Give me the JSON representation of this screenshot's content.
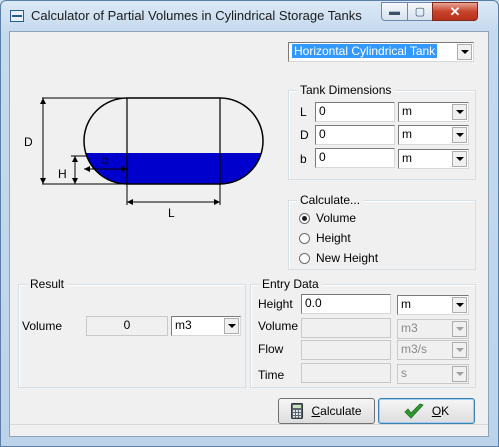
{
  "window": {
    "title": "Calculator of Partial Volumes in Cylindrical Storage Tanks",
    "min_glyph": "▬",
    "max_glyph": "▢",
    "close_glyph": "✕"
  },
  "tank_type": {
    "selected": "Horizontal Cylindrical Tank"
  },
  "diagram": {
    "label_D": "D",
    "label_H": "H",
    "label_b": "b",
    "label_L": "L",
    "liquid_color": "#0000cc"
  },
  "dimensions": {
    "title": "Tank Dimensions",
    "rows": [
      {
        "label": "L",
        "value": "0",
        "unit": "m"
      },
      {
        "label": "D",
        "value": "0",
        "unit": "m"
      },
      {
        "label": "b",
        "value": "0",
        "unit": "m"
      }
    ]
  },
  "calculate": {
    "title": "Calculate...",
    "options": [
      {
        "label": "Volume",
        "selected": true
      },
      {
        "label": "Height",
        "selected": false
      },
      {
        "label": "New Height",
        "selected": false
      }
    ]
  },
  "result": {
    "title": "Result",
    "label": "Volume",
    "value": "0",
    "unit": "m3"
  },
  "entry": {
    "title": "Entry Data",
    "rows": [
      {
        "label": "Height",
        "value": "0.0",
        "unit": "m",
        "enabled": true
      },
      {
        "label": "Volume",
        "value": "",
        "unit": "m3",
        "enabled": false
      },
      {
        "label": "Flow",
        "value": "",
        "unit": "m3/s",
        "enabled": false
      },
      {
        "label": "Time",
        "value": "",
        "unit": "s",
        "enabled": false
      }
    ]
  },
  "buttons": {
    "calculate": "Calculate",
    "calculate_mnemonic": "C",
    "calculate_rest": "alculate",
    "ok": "OK",
    "ok_mnemonic": "O",
    "ok_rest": "K"
  }
}
